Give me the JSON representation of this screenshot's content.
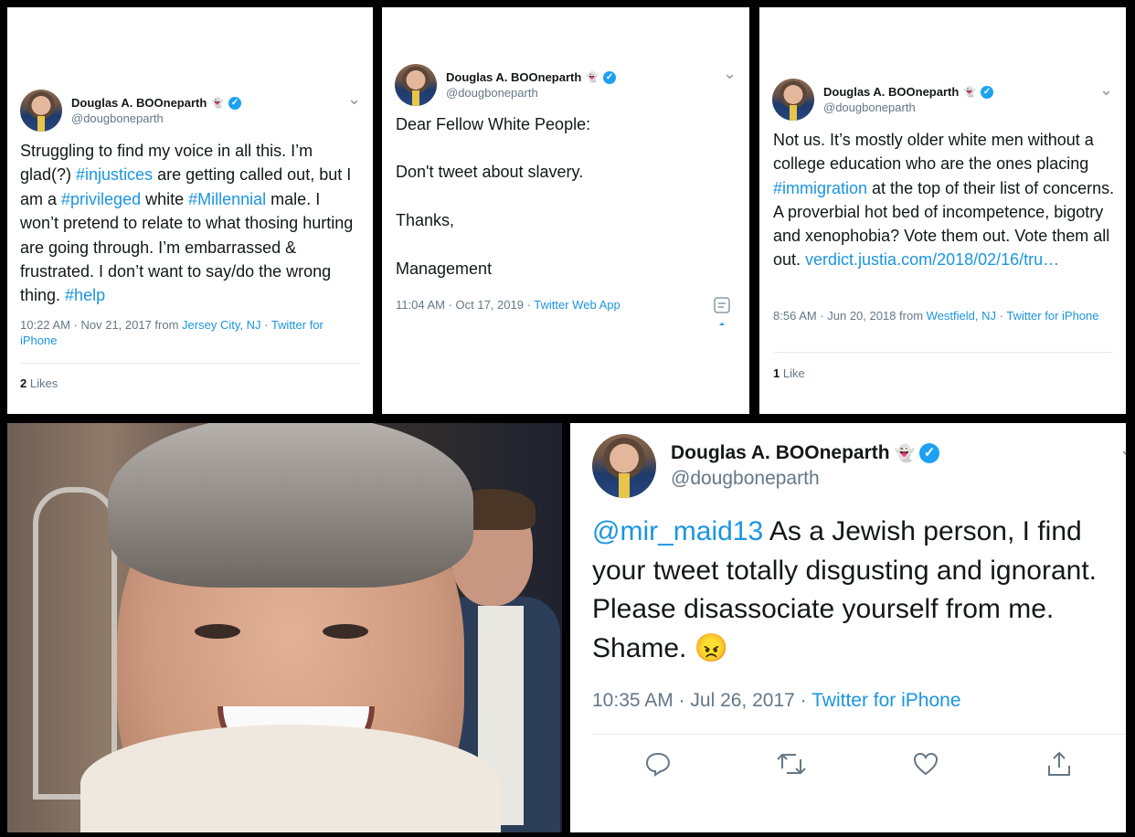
{
  "tweets": [
    {
      "name": "Douglas A. BOOneparth",
      "ghost": "👻",
      "verified": "✓",
      "handle": "@dougboneparth",
      "chevron": "⌄",
      "body": [
        {
          "t": "Struggling to find my voice in all this. I’m glad(?) "
        },
        {
          "t": "#injustices",
          "tag": true
        },
        {
          "t": " are getting called out, but I am a "
        },
        {
          "t": "#privileged",
          "tag": true
        },
        {
          "t": " white "
        },
        {
          "t": "#Millennial",
          "tag": true
        },
        {
          "t": " male. I won’t pretend to relate to what thosing hurting are going through. I’m embarrassed & frustrated. I don’t want to say/do the wrong thing. "
        },
        {
          "t": "#help",
          "tag": true
        }
      ],
      "time": "10:22 AM · Nov 21, 2017 from ",
      "location": "Jersey City, NJ",
      "dot": " · ",
      "source": "Twitter for iPhone",
      "likes_count": "2",
      "likes_label": "Likes"
    },
    {
      "name": "Douglas A. BOOneparth",
      "ghost": "👻",
      "verified": "✓",
      "handle": "@dougboneparth",
      "chevron": "⌄",
      "line1": "Dear Fellow White People:",
      "line2": "Don't tweet about slavery.",
      "line3": "Thanks,",
      "line4": "Management",
      "time": "11:04 AM · Oct 17, 2019 · ",
      "source": "Twitter Web App",
      "analytics_icon": "analytics-icon"
    },
    {
      "name": "Douglas A. BOOneparth",
      "ghost": "👻",
      "verified": "✓",
      "handle": "@dougboneparth",
      "chevron": "⌄",
      "body": [
        {
          "t": "Not us. It’s mostly older white men without a college education who are the ones placing "
        },
        {
          "t": "#immigration",
          "tag": true
        },
        {
          "t": " at the top of their list of concerns. A proverbial hot bed of incompetence, bigotry and xenophobia? Vote them out. Vote them all out. "
        },
        {
          "t": "verdict.justia.com/2018/02/16/tru…",
          "tag": true
        }
      ],
      "time": "8:56 AM · Jun 20, 2018 from ",
      "location": "Westfield, NJ",
      "dot": " · ",
      "source": "Twitter for iPhone",
      "likes_count": "1",
      "likes_label": "Like"
    },
    {
      "name": "Douglas A. BOOneparth",
      "ghost": "👻",
      "verified": "✓",
      "handle": "@dougboneparth",
      "chevron": "⌄",
      "mention": "@mir_maid13",
      "text": " As a Jewish person, I find your tweet totally disgusting and ignorant. Please disassociate yourself from me. Shame. 😠",
      "time": "10:35 AM · Jul 26, 2017 · ",
      "source": "Twitter for iPhone",
      "actions": [
        "reply-icon",
        "retweet-icon",
        "like-icon",
        "share-icon"
      ]
    }
  ],
  "colors": {
    "link": "#1b95e0",
    "verified": "#1da1f2",
    "muted": "#657786"
  }
}
